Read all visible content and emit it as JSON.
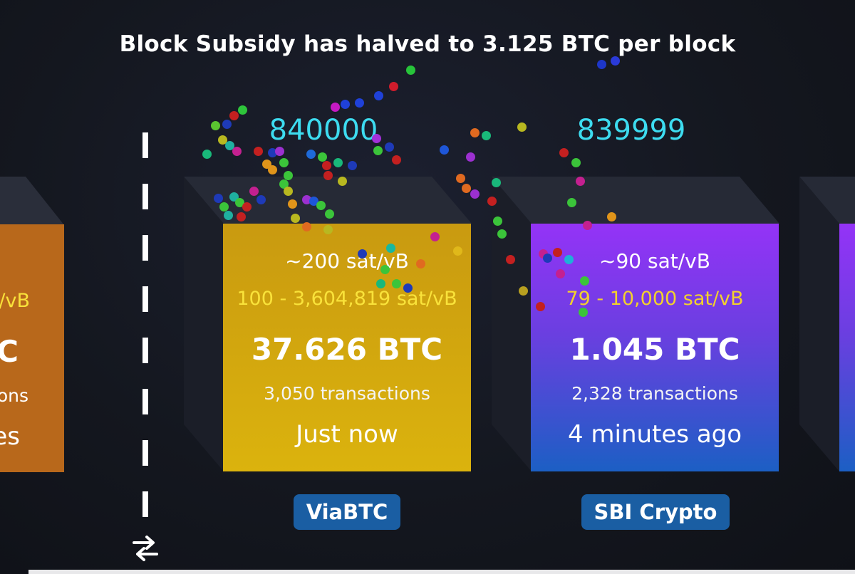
{
  "banner": {
    "text": "Block Subsidy has halved to 3.125 BTC per block"
  },
  "blocks": [
    {
      "height": "840000",
      "median_fee": "~200 sat/vB",
      "fee_range": "100 - 3,604,819 sat/vB",
      "total": "37.626 BTC",
      "transactions": "3,050 transactions",
      "age": "Just now",
      "pool": "ViaBTC",
      "color_top": "#c99a10",
      "color_bottom": "#dbb30d",
      "fee_range_color": "#f9e23a"
    },
    {
      "height": "839999",
      "median_fee": "~90 sat/vB",
      "fee_range": "79 - 10,000 sat/vB",
      "total": "1.045 BTC",
      "transactions": "2,328 transactions",
      "age": "4 minutes ago",
      "pool": "SBI Crypto",
      "color_top": "#9433f7",
      "color_bottom": "#1c5fc4",
      "fee_range_color": "#f3d12c"
    }
  ],
  "mempool_block_partial": {
    "fee_range_fragment": "/vB",
    "total_fragment": "C",
    "transactions_fragment": "ons",
    "age_fragment": "es",
    "color": "#b8681b"
  },
  "icons": {
    "swap": "swap-arrows-icon"
  },
  "colors": {
    "height_text": "#3ddcf0",
    "pool_badge": "#1a5ea3"
  }
}
